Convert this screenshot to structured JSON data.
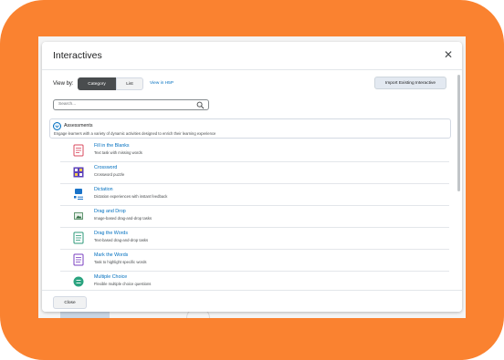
{
  "dialog": {
    "title": "Interactives",
    "close_icon": "close-icon"
  },
  "toolbar": {
    "view_by_label": "View by:",
    "tabs": [
      {
        "label": "Category",
        "selected": true
      },
      {
        "label": "List",
        "selected": false
      }
    ],
    "view_h5p_link": "View in H5P",
    "import_button": "Import Existing Interactive"
  },
  "search": {
    "placeholder": "Search...",
    "icon": "search-icon"
  },
  "category": {
    "name": "Assessments",
    "description": "Engage learners with a variety of dynamic activities designed to enrich their learning experience",
    "expanded": true
  },
  "items": [
    {
      "name": "Fill in the Blanks",
      "description": "Text task with missing words",
      "icon": "fill-in-the-blanks-icon"
    },
    {
      "name": "Crossword",
      "description": "Crossword puzzle",
      "icon": "crossword-icon"
    },
    {
      "name": "Dictation",
      "description": "Dictation experiences with instant feedback",
      "icon": "dictation-icon"
    },
    {
      "name": "Drag and Drop",
      "description": "Image-based drag-and-drop tasks",
      "icon": "drag-and-drop-icon"
    },
    {
      "name": "Drag the Words",
      "description": "Text-based drag-and-drop tasks",
      "icon": "drag-the-words-icon"
    },
    {
      "name": "Mark the Words",
      "description": "Task to highlight specific words",
      "icon": "mark-the-words-icon"
    },
    {
      "name": "Multiple Choice",
      "description": "Flexible multiple choice questions",
      "icon": "multiple-choice-icon"
    }
  ],
  "footer": {
    "close_button": "Close"
  },
  "colors": {
    "frame": "#fa8230",
    "link": "#006fbf",
    "selected_tab": "#494c4e"
  }
}
